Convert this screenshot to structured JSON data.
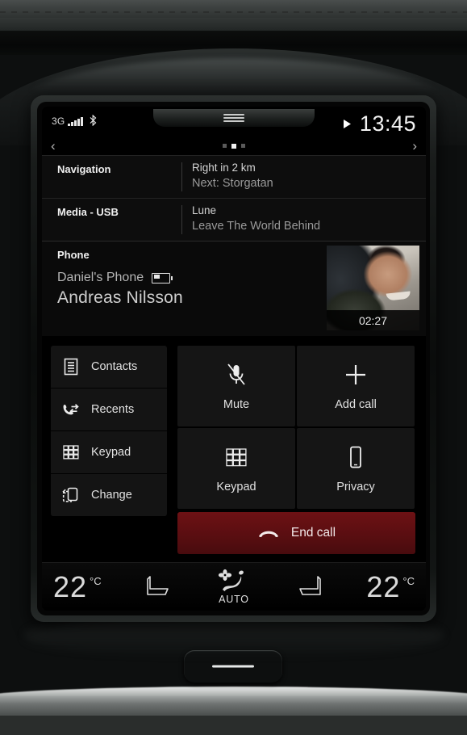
{
  "status_bar": {
    "network": "3G",
    "signal_bars": 5,
    "bluetooth_icon": "bluetooth-icon",
    "play_icon": "play-icon",
    "clock": "13:45"
  },
  "pager": {
    "prev_icon": "chevron-left-icon",
    "next_icon": "chevron-right-icon",
    "dots": 3,
    "active_dot": 2
  },
  "tiles": [
    {
      "label": "Navigation",
      "line1": "Right in 2 km",
      "line2": "Next: Storgatan"
    },
    {
      "label": "Media - USB",
      "line1": "Lune",
      "line2": "Leave The World Behind"
    }
  ],
  "phone": {
    "label": "Phone",
    "device": "Daniel's Phone",
    "battery_icon": "battery-low-icon",
    "caller": "Andreas Nilsson",
    "call_duration": "02:27",
    "photo_alt": "caller-photo"
  },
  "left_menu": [
    {
      "label": "Contacts",
      "icon": "contacts-list-icon"
    },
    {
      "label": "Recents",
      "icon": "recent-calls-icon"
    },
    {
      "label": "Keypad",
      "icon": "keypad-grid-icon"
    },
    {
      "label": "Change",
      "icon": "change-device-icon"
    }
  ],
  "call_controls": [
    {
      "label": "Mute",
      "icon": "microphone-muted-icon"
    },
    {
      "label": "Add call",
      "icon": "plus-icon"
    },
    {
      "label": "Keypad",
      "icon": "keypad-grid-icon"
    },
    {
      "label": "Privacy",
      "icon": "phone-handset-icon"
    }
  ],
  "end_call": {
    "label": "End call",
    "icon": "end-call-handset-icon",
    "color": "#5a0e11"
  },
  "climate": {
    "left_temp": "22",
    "left_unit": "°C",
    "right_temp": "22",
    "right_unit": "°C",
    "left_seat_icon": "seat-left-icon",
    "right_seat_icon": "seat-right-icon",
    "auto_icon": "fan-airflow-icon",
    "auto_label": "AUTO"
  },
  "theme": {
    "screen_bg": "#000000",
    "tile_bg": "#0d0d0d",
    "button_bg": "#151515",
    "text_primary": "#e2e2e2",
    "text_secondary": "#9a9a9a",
    "end_call_red": "#5a0e11"
  }
}
